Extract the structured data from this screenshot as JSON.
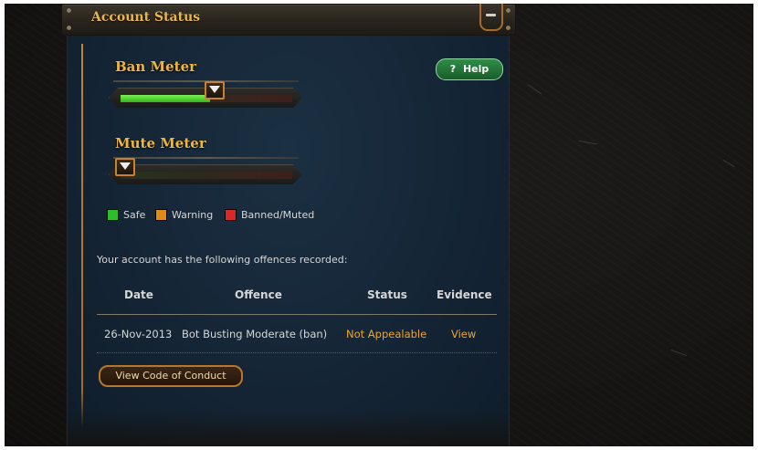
{
  "panel": {
    "title": "Account Status",
    "help_label": "Help",
    "help_icon": "question-mark-icon",
    "collapse_icon": "minus-icon"
  },
  "meters": {
    "ban": {
      "title": "Ban Meter",
      "level": 0.52
    },
    "mute": {
      "title": "Mute Meter",
      "level": 0.0
    }
  },
  "legend": [
    {
      "label": "Safe",
      "color": "#2ebd2b"
    },
    {
      "label": "Warning",
      "color": "#e08a1a"
    },
    {
      "label": "Banned/Muted",
      "color": "#d8282a"
    }
  ],
  "offences": {
    "intro": "Your account has the following offences recorded:",
    "columns": [
      "Date",
      "Offence",
      "Status",
      "Evidence"
    ],
    "rows": [
      {
        "date": "26-Nov-2013",
        "offence": "Bot Busting Moderate (ban)",
        "status": "Not Appealable",
        "evidence": "View"
      }
    ]
  },
  "code_of_conduct_label": "View Code of Conduct",
  "colors": {
    "accent_gold": "#f0b63c",
    "link_orange": "#f0a52b",
    "help_green": "#2f8e48",
    "panel_blue": "#142434"
  }
}
